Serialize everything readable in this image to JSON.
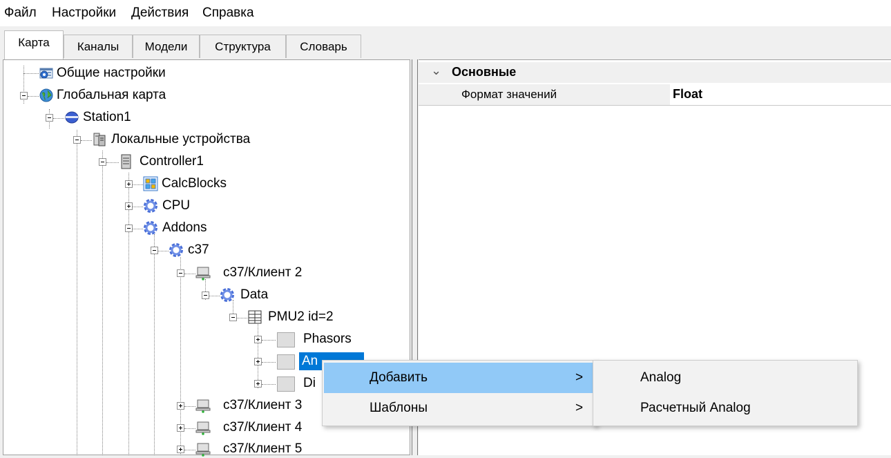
{
  "menubar": {
    "items": [
      "Файл",
      "Настройки",
      "Действия",
      "Справка"
    ]
  },
  "tabs": [
    "Карта",
    "Каналы",
    "Модели",
    "Структура",
    "Словарь"
  ],
  "tree": {
    "general": "Общие настройки",
    "global_map": "Глобальная карта",
    "station": "Station1",
    "local_devices": "Локальные устройства",
    "controller": "Controller1",
    "calcblocks": "CalcBlocks",
    "cpu": "CPU",
    "addons": "Addons",
    "c37": "c37",
    "client2": "c37/Клиент 2",
    "data": "Data",
    "pmu": "PMU2 id=2",
    "phasors": "Phasors",
    "analogs_partial": "An",
    "digitals_partial": "Di",
    "client3": "c37/Клиент 3",
    "client4": "c37/Клиент 4",
    "client5": "c37/Клиент 5"
  },
  "properties": {
    "category": "Основные",
    "rows": [
      {
        "name": "Формат значений",
        "value": "Float"
      }
    ]
  },
  "context_menu": {
    "items": [
      {
        "label": "Добавить",
        "arrow": ">"
      },
      {
        "label": "Шаблоны",
        "arrow": ">"
      }
    ],
    "submenu": [
      "Analog",
      "Расчетный Analog"
    ]
  }
}
